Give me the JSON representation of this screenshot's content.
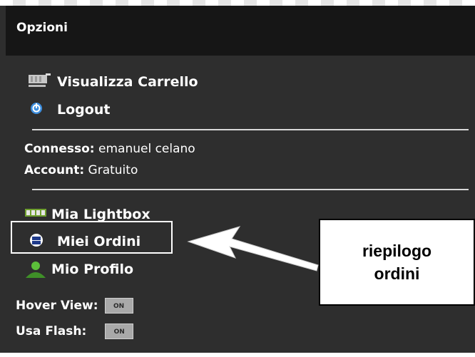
{
  "panel": {
    "title": "Opzioni"
  },
  "menu": {
    "cart_label": "Visualizza Carrello",
    "logout_label": "Logout",
    "lightbox_label": "Mia Lightbox",
    "orders_label": "Miei Ordini",
    "profile_label": "Mio Profilo"
  },
  "user": {
    "connected_label": "Connesso:",
    "connected_value": "emanuel celano",
    "account_label": "Account:",
    "account_value": "Gratuito"
  },
  "settings": {
    "hover_view_label": "Hover View:",
    "hover_view_state": "ON",
    "flash_label": "Usa Flash:",
    "flash_state": "ON"
  },
  "annotation": {
    "text": "riepilogo\nordini"
  },
  "icons": {
    "cart": "shopping-cart-icon",
    "logout": "power-icon",
    "lightbox": "film-strip-icon",
    "orders": "orders-icon",
    "profile": "user-profile-icon"
  },
  "colors": {
    "panel_bg": "#2e2e2e",
    "header_bg": "#161616",
    "text": "#ffffff",
    "toggle_bg": "#a9a9a9",
    "logout_icon": "#3d8fe0",
    "profile_icon": "#4aa83a"
  }
}
